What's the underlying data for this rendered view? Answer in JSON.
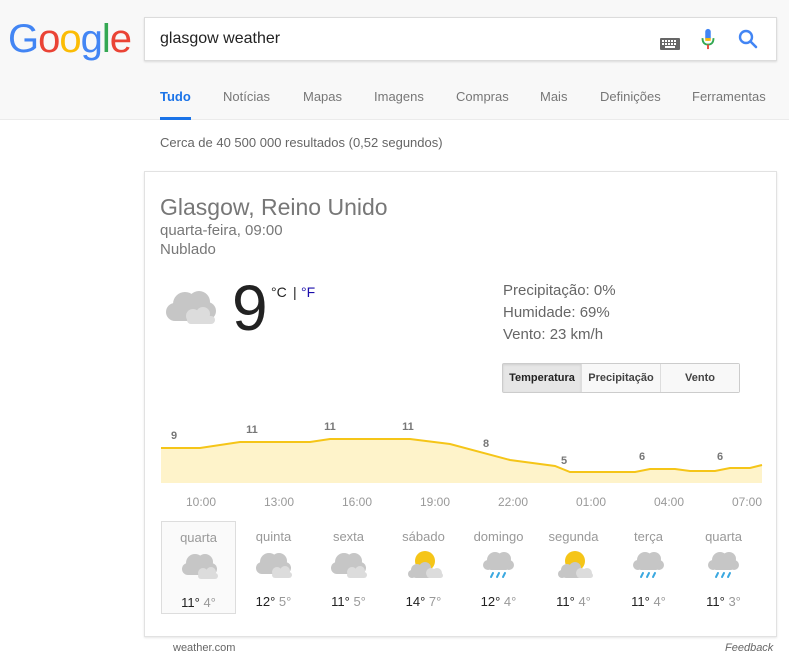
{
  "logo": {
    "letters": [
      "G",
      "o",
      "o",
      "g",
      "l",
      "e"
    ],
    "colors": [
      "#4285F4",
      "#EA4335",
      "#FBBC05",
      "#4285F4",
      "#34A853",
      "#EA4335"
    ]
  },
  "search": {
    "query": "glasgow weather"
  },
  "tabs": [
    {
      "label": "Tudo",
      "active": true
    },
    {
      "label": "Notícias"
    },
    {
      "label": "Mapas"
    },
    {
      "label": "Imagens"
    },
    {
      "label": "Compras"
    },
    {
      "label": "Mais"
    },
    {
      "label": "Definições"
    },
    {
      "label": "Ferramentas"
    }
  ],
  "result_stats": "Cerca de 40 500 000 resultados (0,52 segundos)",
  "weather": {
    "location": "Glasgow, Reino Unido",
    "datetime": "quarta-feira, 09:00",
    "condition": "Nublado",
    "temperature": "9",
    "unit_c": "°C",
    "unit_sep": "|",
    "unit_f": "°F",
    "precipitation": "Precipitação: 0%",
    "humidity": "Humidade: 69%",
    "wind": "Vento: 23 km/h",
    "toggles": [
      "Temperatura",
      "Precipitação",
      "Vento"
    ],
    "active_toggle": "Temperatura",
    "accent_color": "#F5C518",
    "hours": [
      "10:00",
      "13:00",
      "16:00",
      "19:00",
      "22:00",
      "01:00",
      "04:00",
      "07:00"
    ],
    "hourly_labels": [
      "9",
      "11",
      "11",
      "11",
      "8",
      "5",
      "6",
      "6"
    ],
    "days": [
      {
        "name": "quarta",
        "icon": "rain-cloud-icon",
        "high": "11°",
        "low": "4°",
        "active": true
      },
      {
        "name": "quinta",
        "icon": "cloud-icon",
        "high": "12°",
        "low": "5°"
      },
      {
        "name": "sexta",
        "icon": "cloud-icon",
        "high": "11°",
        "low": "5°"
      },
      {
        "name": "sábado",
        "icon": "partly-sunny-icon",
        "high": "14°",
        "low": "7°"
      },
      {
        "name": "domingo",
        "icon": "showers-icon",
        "high": "12°",
        "low": "4°"
      },
      {
        "name": "segunda",
        "icon": "partly-sunny-icon",
        "high": "11°",
        "low": "4°"
      },
      {
        "name": "terça",
        "icon": "showers-icon",
        "high": "11°",
        "low": "4°"
      },
      {
        "name": "quarta",
        "icon": "showers-icon",
        "high": "11°",
        "low": "3°"
      }
    ]
  },
  "source": "weather.com",
  "feedback": "Feedback"
}
